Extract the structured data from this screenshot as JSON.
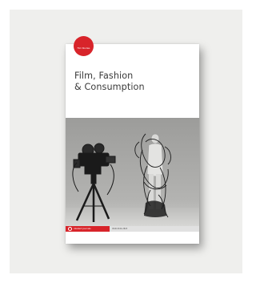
{
  "cover": {
    "badge_text": "Film Studies",
    "title_lines": [
      "Film, Fashion",
      "& Consumption"
    ],
    "footer_publisher": "intellect Journals",
    "footer_issn": "ISSN 2044-2823",
    "accent_color": "#d8242a",
    "photo_description_icon": "film-camera-and-wired-mannequin-photo"
  }
}
